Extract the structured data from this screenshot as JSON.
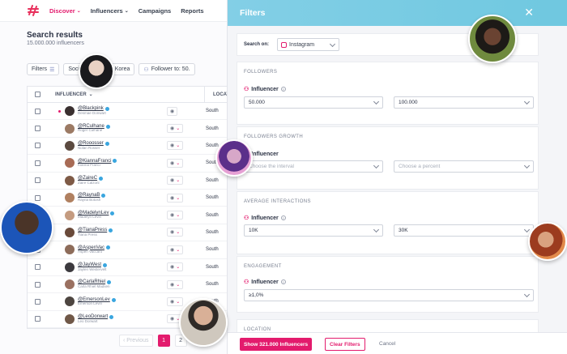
{
  "nav": {
    "items": [
      {
        "label": "Discover",
        "has_dropdown": true,
        "active": true
      },
      {
        "label": "Influencers",
        "has_dropdown": true,
        "active": false
      },
      {
        "label": "Campaigns",
        "has_dropdown": false,
        "active": false
      },
      {
        "label": "Reports",
        "has_dropdown": false,
        "active": false
      }
    ]
  },
  "search": {
    "title": "Search results",
    "count": "15.000.000 influencers",
    "chips": [
      {
        "label": "Filters",
        "icon": "sliders-icon"
      },
      {
        "label": "Soci",
        "icon": ""
      },
      {
        "label": "South Korea",
        "icon": "location-icon"
      },
      {
        "label": "Follower to: 50.",
        "icon": "user-icon"
      }
    ]
  },
  "table": {
    "col_influencer": "INFLUENCER",
    "col_location": "LOCAT",
    "rows": [
      {
        "handle": "@Blackpink",
        "name": "Desmae Donwart",
        "loc": "South",
        "color": "#3a3030"
      },
      {
        "handle": "@RCulhane",
        "name": "Roger Culhane",
        "loc": "South",
        "color": "#9c7a64"
      },
      {
        "handle": "@Rooosser",
        "name": "Nolan Rosser",
        "loc": "South",
        "color": "#5b4a40"
      },
      {
        "handle": "@KiannaFranci",
        "name": "Kianna Franci",
        "loc": "South",
        "color": "#a86b55"
      },
      {
        "handle": "@ZaireC",
        "name": "Zaire Calzoni",
        "loc": "South",
        "color": "#7e5a46"
      },
      {
        "handle": "@RaynaB",
        "name": "Rayna Botosh",
        "loc": "South",
        "color": "#b08060"
      },
      {
        "handle": "@MadelynLev",
        "name": "Madelyn Levin",
        "loc": "South",
        "color": "#c49b80"
      },
      {
        "handle": "@TianaPress",
        "name": "Tiana Press",
        "loc": "South",
        "color": "#6a4a3a"
      },
      {
        "handle": "@AspenVac",
        "name": "Aspen Vaccaro",
        "loc": "South",
        "color": "#8d6c5a"
      },
      {
        "handle": "@JayWest",
        "name": "Jaylen Westervelt",
        "loc": "South",
        "color": "#3c3a3e"
      },
      {
        "handle": "@CarlaRhiel",
        "name": "Carla Rhiel Madsen",
        "loc": "South",
        "color": "#9a7060"
      },
      {
        "handle": "@EmersonLev",
        "name": "Emerson Levin",
        "loc": "South",
        "color": "#4d4540"
      },
      {
        "handle": "@LeoDorwart",
        "name": "Leo Dorwart",
        "loc": "South",
        "color": "#705848"
      }
    ]
  },
  "pager": {
    "prev": "Previous",
    "pages": [
      "1",
      "2"
    ],
    "active": "1"
  },
  "panel": {
    "title": "Filters",
    "search_on_label": "Search on:",
    "platform": "Instagram",
    "followers": {
      "label": "FOLLOWERS",
      "sub": "Influencer",
      "from": "50.000",
      "to": "100.000"
    },
    "growth": {
      "label": "FOLLOWERS GROWTH",
      "sub": "Influencer",
      "interval_placeholder": "Choose the interval",
      "percent_placeholder": "Choose a percent"
    },
    "interactions": {
      "label": "AVERAGE INTERACTIONS",
      "sub": "Influencer",
      "from": "10K",
      "to": "30K"
    },
    "engagement": {
      "label": "ENGAGEMENT",
      "sub": "Influencer",
      "value": "≥1,0%"
    },
    "location": {
      "label": "LOCATION"
    },
    "show_button": "Show 321.000 Influencers",
    "clear_button": "Clear Filters",
    "cancel_button": "Cancel"
  },
  "colors": {
    "accent": "#e31b6d",
    "header": "#7ccde4"
  }
}
